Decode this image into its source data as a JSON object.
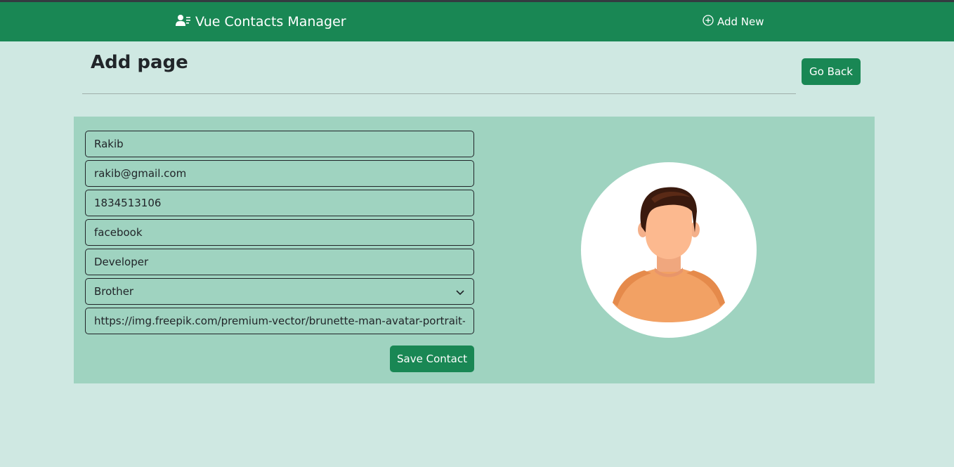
{
  "nav": {
    "brand": "Vue Contacts Manager",
    "add_new": "Add New"
  },
  "page": {
    "title": "Add page",
    "go_back": "Go Back"
  },
  "form": {
    "name": "Rakib",
    "email": "rakib@gmail.com",
    "mobile": "1834513106",
    "company": "facebook",
    "title": "Developer",
    "group": "Brother",
    "photo_url": "https://img.freepik.com/premium-vector/brunette-man-avatar-portrait-yc",
    "save_label": "Save Contact"
  },
  "icons": {
    "brand": "user-list-icon",
    "add_new": "plus-circle-icon",
    "select": "chevron-down-icon"
  },
  "colors": {
    "primary": "#198754",
    "background": "#cfe8e2",
    "panel": "#9fd3c0"
  }
}
